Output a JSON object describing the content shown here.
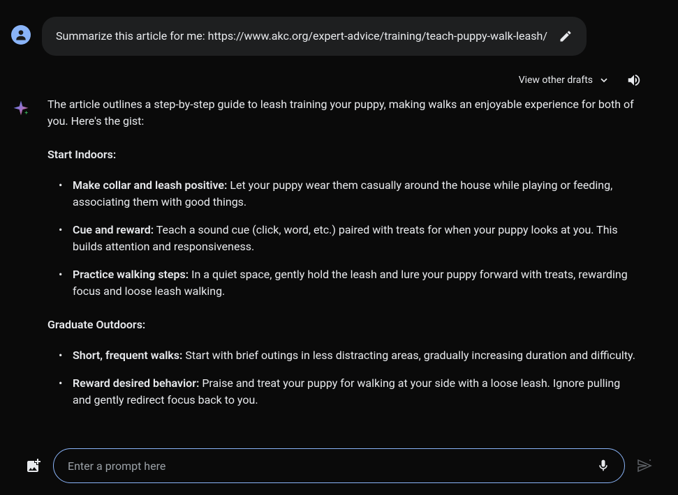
{
  "user": {
    "message": "Summarize this article for me: https://www.akc.org/expert-advice/training/teach-puppy-walk-leash/"
  },
  "header": {
    "view_drafts": "View other drafts"
  },
  "assistant": {
    "intro": "The article outlines a step-by-step guide to leash training your puppy, making walks an enjoyable experience for both of you. Here's the gist:",
    "sections": [
      {
        "heading": "Start Indoors:",
        "bullets": [
          {
            "title": "Make collar and leash positive:",
            "text": " Let your puppy wear them casually around the house while playing or feeding, associating them with good things."
          },
          {
            "title": "Cue and reward:",
            "text": " Teach a sound cue (click, word, etc.) paired with treats for when your puppy looks at you. This builds attention and responsiveness."
          },
          {
            "title": "Practice walking steps:",
            "text": " In a quiet space, gently hold the leash and lure your puppy forward with treats, rewarding focus and loose leash walking."
          }
        ]
      },
      {
        "heading": "Graduate Outdoors:",
        "bullets": [
          {
            "title": "Short, frequent walks:",
            "text": " Start with brief outings in less distracting areas, gradually increasing duration and difficulty."
          },
          {
            "title": "Reward desired behavior:",
            "text": " Praise and treat your puppy for walking at your side with a loose leash. Ignore pulling and gently redirect focus back to you."
          }
        ]
      }
    ]
  },
  "input": {
    "placeholder": "Enter a prompt here"
  }
}
